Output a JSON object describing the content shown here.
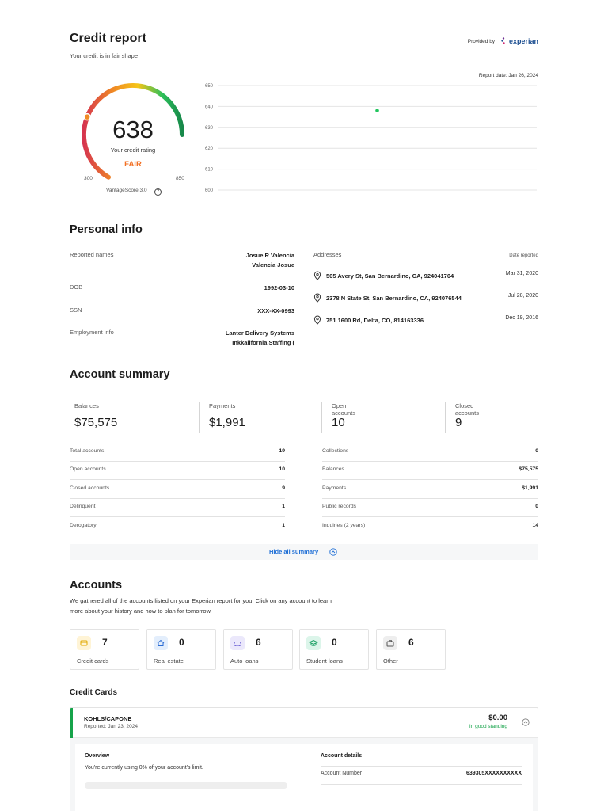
{
  "header": {
    "title": "Credit report",
    "subtitle": "Your credit is in fair shape",
    "provided_by": "Provided by",
    "provider": "experian",
    "report_date": "Report date: Jan 26, 2024"
  },
  "gauge": {
    "score": "638",
    "score_value": 638,
    "min_value": 300,
    "max_value": 850,
    "caption": "Your credit rating",
    "rating": "FAIR",
    "min_label": "300",
    "max_label": "850",
    "model": "VantageScore 3.0",
    "colors": {
      "red": "#d6354f",
      "orange": "#f08a24",
      "yellow": "#f5c518",
      "green": "#2cbf5a",
      "dark_green": "#17884a",
      "rating": "#f26f22"
    }
  },
  "chart_data": {
    "type": "scatter",
    "x": [
      "Jan 26, 2024"
    ],
    "y": [
      638
    ],
    "yticks": [
      650,
      640,
      630,
      620,
      610,
      600
    ],
    "ylim": [
      600,
      650
    ],
    "grid": true,
    "point_color": "#22c55e"
  },
  "personal_info": {
    "title": "Personal info",
    "reported_names_label": "Reported names",
    "names": [
      "Josue R Valencia",
      "Valencia Josue"
    ],
    "dob_label": "DOB",
    "dob": "1992-03-10",
    "ssn_label": "SSN",
    "ssn": "XXX-XX-0993",
    "employment_label": "Employment info",
    "employers": [
      "Lanter Delivery Systems",
      "Inkkalifornia Staffing ("
    ],
    "addresses_label": "Addresses",
    "date_reported_label": "Date reported",
    "addresses": [
      {
        "address": "505 Avery St, San Bernardino, CA, 924041704",
        "date": "Mar 31, 2020"
      },
      {
        "address": "2378 N State St, San Bernardino, CA, 924076544",
        "date": "Jul 28, 2020"
      },
      {
        "address": "751 1600 Rd, Delta, CO, 814163336",
        "date": "Dec 19, 2016"
      }
    ]
  },
  "account_summary": {
    "title": "Account summary",
    "stats": [
      {
        "label": "Balances",
        "value": "$75,575"
      },
      {
        "label": "Payments",
        "value": "$1,991"
      },
      {
        "label": "Open accounts",
        "value": "10"
      },
      {
        "label": "Closed accounts",
        "value": "9"
      }
    ],
    "left_rows": [
      {
        "label": "Total accounts",
        "value": "19"
      },
      {
        "label": "Open accounts",
        "value": "10"
      },
      {
        "label": "Closed accounts",
        "value": "9"
      },
      {
        "label": "Delinquent",
        "value": "1"
      },
      {
        "label": "Derogatory",
        "value": "1"
      }
    ],
    "right_rows": [
      {
        "label": "Collections",
        "value": "0"
      },
      {
        "label": "Balances",
        "value": "$75,575"
      },
      {
        "label": "Payments",
        "value": "$1,991"
      },
      {
        "label": "Public records",
        "value": "0"
      },
      {
        "label": "Inquiries (2 years)",
        "value": "14"
      }
    ],
    "hide_label": "Hide all summary"
  },
  "accounts": {
    "title": "Accounts",
    "description_1": "We gathered all of the accounts listed on your Experian report for you. Click on any account to learn",
    "description_2": "more about your history and how to plan for tomorrow.",
    "types": [
      {
        "label": "Credit cards",
        "count": "7",
        "icon": "credit-card-icon",
        "bg": "#fff4d6",
        "fg": "#e0a800"
      },
      {
        "label": "Real estate",
        "count": "0",
        "icon": "home-icon",
        "bg": "#e3eefc",
        "fg": "#2b6cd4"
      },
      {
        "label": "Auto loans",
        "count": "6",
        "icon": "car-icon",
        "bg": "#ebe8fb",
        "fg": "#5a4fcf"
      },
      {
        "label": "Student loans",
        "count": "0",
        "icon": "graduation-cap-icon",
        "bg": "#dcf5ea",
        "fg": "#1a9f63"
      },
      {
        "label": "Other",
        "count": "6",
        "icon": "briefcase-icon",
        "bg": "#eeeeee",
        "fg": "#555555"
      }
    ]
  },
  "credit_cards": {
    "title": "Credit Cards",
    "account": {
      "name": "KOHLS/CAPONE",
      "reported": "Reported: Jan 23, 2024",
      "balance": "$0.00",
      "standing": "In good standing",
      "overview_title": "Overview",
      "overview_text": "You're currently using 0% of your account's limit.",
      "utilization": 0,
      "details_title": "Account details",
      "account_number_label": "Account Number",
      "account_number": "639305XXXXXXXXXX"
    }
  }
}
